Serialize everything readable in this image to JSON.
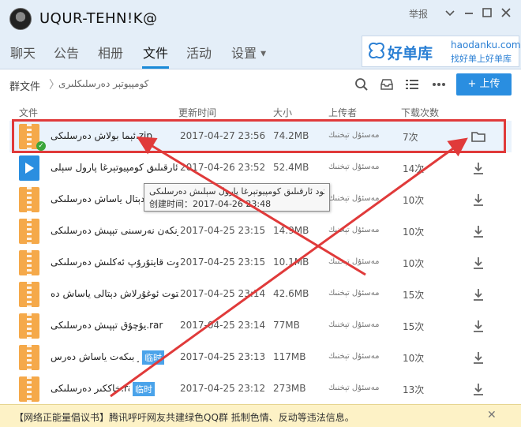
{
  "window": {
    "title": "UQUR-TEHN!K@",
    "report_label": "举报",
    "controls": [
      "chevron-down-icon",
      "minimize-icon",
      "maximize-icon",
      "close-icon"
    ]
  },
  "nav": {
    "tabs": [
      "聊天",
      "公告",
      "相册",
      "文件",
      "活动",
      "设置"
    ],
    "active_tab": "文件"
  },
  "ad": {
    "brand": "好单库",
    "url": "haodanku.com",
    "slogan": "找好单上好单库"
  },
  "toolbar": {
    "breadcrumb_root": "群文件",
    "breadcrumb_current": "كومپيوتېر دەرسلىكلىرى",
    "upload_label": "+ 上传"
  },
  "table": {
    "headers": {
      "file": "文件",
      "time": "更新时间",
      "size": "大小",
      "uploader": "上传者",
      "downloads": "下载次数"
    },
    "temp_label": "临时",
    "rows": [
      {
        "name": "ئېما بولاش دەرسلىكى.zip",
        "time": "2017-04-27 23:56",
        "size": "74.2MB",
        "uploader": "مەسئۇل تېخنىك",
        "count": "7次",
        "icon": "zip",
        "action": "folder-icon"
      },
      {
        "name": "كود ئارقىلىق كومپيوتېرغا پارول سېلى",
        "time": "2017-04-26 23:52",
        "size": "52.4MB",
        "uploader": "مەسئۇل تېخنىك",
        "count": "14次",
        "icon": "video",
        "action": "download-icon"
      },
      {
        "name": "ئېكسىل دېتال ياساش دەرسلىكى",
        "time": "",
        "size": "",
        "uploader": "مەسئۇل تېخنىك",
        "count": "10次",
        "icon": "zip",
        "action": "download-icon"
      },
      {
        "name": "يونكەن نەرسىنى تېپىش دەرسلىكى.zip",
        "time": "2017-04-25 23:15",
        "size": "14.9MB",
        "uploader": "مەسئۇل تېخنىك",
        "count": "10次",
        "icon": "zip",
        "action": "download-icon"
      },
      {
        "name": "كونتوت قايتۇرۇپ ئەكلىش دەرسلىكى",
        "time": "2017-04-25 23:15",
        "size": "10.1MB",
        "uploader": "مەسئۇل تېخنىك",
        "count": "10次",
        "icon": "zip",
        "action": "download-icon"
      },
      {
        "name": "كونتوت ئوغۇرلاش دېتالى ياساش دە...",
        "time": "2017-04-25 23:14",
        "size": "42.6MB",
        "uploader": "مەسئۇل تېخنىك",
        "count": "15次",
        "icon": "zip",
        "action": "download-icon"
      },
      {
        "name": "يۇچۇق تېپىش دەرسلىكى.rar",
        "time": "2017-04-25 23:14",
        "size": "77MB",
        "uploader": "مەسئۇل تېخنىك",
        "count": "15次",
        "icon": "zip",
        "action": "download-icon",
        "temp": false
      },
      {
        "name": "تور بىكەت ياساش دەرس...",
        "time": "2017-04-25 23:13",
        "size": "117MB",
        "uploader": "مەسئۇل تېخنىك",
        "count": "10次",
        "icon": "zip",
        "action": "download-icon",
        "temp": true
      },
      {
        "name": "خاككىر دەرسلىكى.rar",
        "time": "2017-04-25 23:12",
        "size": "273MB",
        "uploader": "مەسئۇل تېخنىك",
        "count": "13次",
        "icon": "zip",
        "action": "download-icon",
        "temp": true
      }
    ]
  },
  "tooltip": {
    "line1": "كود ئارقىلىق كومپيوتېرغا پارول سېلىش دەرسلىكى.mp4",
    "line2": "创建时间：2017-04-26 23:48"
  },
  "notice": {
    "text": "【网络正能量倡议书】腾讯呼吁网友共建绿色QQ群 抵制色情、反动等违法信息。"
  },
  "annotation_color": "#e03a3a"
}
